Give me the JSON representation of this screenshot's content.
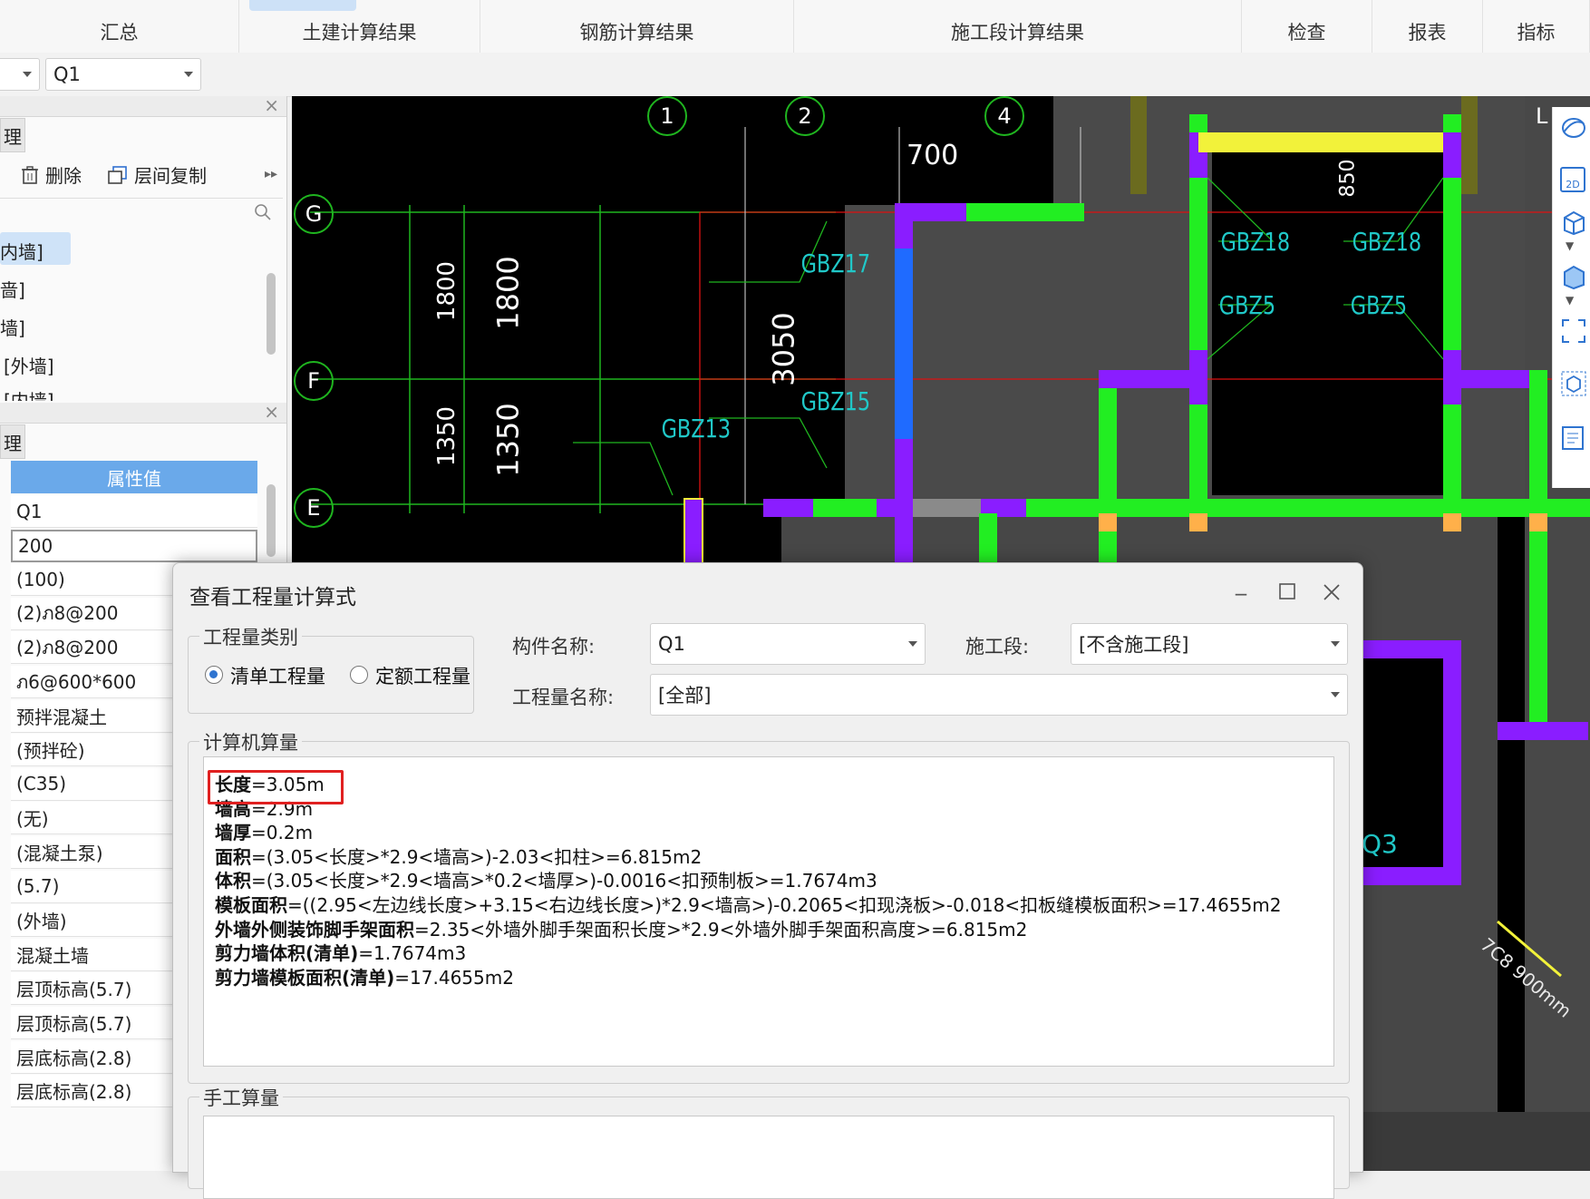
{
  "tabs": [
    "汇总",
    "土建计算结果",
    "钢筋计算结果",
    "施工段计算结果",
    "检查",
    "报表",
    "指标"
  ],
  "toolbar": {
    "component_combo": "Q1"
  },
  "left_panel": {
    "tab1_label": "理",
    "delete_label": "删除",
    "copy_label": "层间复制",
    "tree_items": [
      "内墙]",
      "啬]",
      "墙]",
      "[外墙]",
      "[内墙]"
    ],
    "tab2_label": "理",
    "prop_header": "属性值",
    "prop_values": [
      "Q1",
      "200",
      "(100)",
      "(2)ภ8@200",
      "(2)ภ8@200",
      "ภ6@600*600",
      "预拌混凝土",
      "(预拌砼)",
      "(C35)",
      "(无)",
      "(混凝土泵)",
      "(5.7)",
      "(外墙)",
      "混凝土墙",
      "层顶标高(5.7)",
      "层顶标高(5.7)",
      "层底标高(2.8)",
      "层底标高(2.8)"
    ]
  },
  "cad": {
    "axis_labels": [
      "1",
      "2",
      "4",
      "G",
      "F",
      "E",
      "L"
    ],
    "dimensions": [
      "700",
      "1800",
      "1800",
      "1350",
      "1350",
      "3050",
      "850"
    ],
    "component_labels": [
      "GBZ17",
      "GBZ15",
      "GBZ13",
      "GBZ18",
      "GBZ18",
      "GBZ5",
      "GBZ5",
      "Q3"
    ],
    "note": "7C8 900mm"
  },
  "dialog": {
    "title": "查看工程量计算式",
    "qty_type_group": "工程量类别",
    "radio_bill": "清单工程量",
    "radio_quota": "定额工程量",
    "component_name_label": "构件名称:",
    "component_name_value": "Q1",
    "section_label": "施工段:",
    "section_value": "[不含施工段]",
    "qty_name_label": "工程量名称:",
    "qty_name_value": "[全部]",
    "computer_group": "计算机算量",
    "formulas": [
      {
        "name": "长度",
        "expr": "=3.05m"
      },
      {
        "name": "墙高",
        "expr": "=2.9m"
      },
      {
        "name": "墙厚",
        "expr": "=0.2m"
      },
      {
        "name": "面积",
        "expr": "=(3.05<长度>*2.9<墙高>)-2.03<扣柱>=6.815m2"
      },
      {
        "name": "体积",
        "expr": "=(3.05<长度>*2.9<墙高>*0.2<墙厚>)-0.0016<扣预制板>=1.7674m3"
      },
      {
        "name": "模板面积",
        "expr": "=((2.95<左边线长度>+3.15<右边线长度>)*2.9<墙高>)-0.2065<扣现浇板>-0.018<扣板缝模板面积>=17.4655m2"
      },
      {
        "name": "外墙外侧装饰脚手架面积",
        "expr": "=2.35<外墙外脚手架面积长度>*2.9<外墙外脚手架面积高度>=6.815m2"
      },
      {
        "name": "剪力墙体积(清单)",
        "expr": "=1.7674m3"
      },
      {
        "name": "剪力墙模板面积(清单)",
        "expr": "=17.4655m2"
      }
    ],
    "manual_group": "手工算量"
  }
}
